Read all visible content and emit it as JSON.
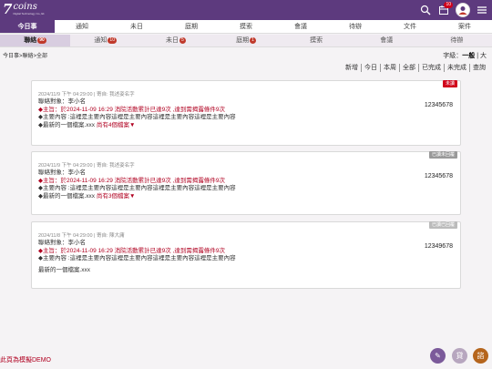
{
  "header": {
    "logo_mark": "7",
    "logo_name": "coins",
    "logo_sub": "Digital Technology Co.,ltd.",
    "notification_count": "10"
  },
  "tabs1": [
    "今日事",
    "通知",
    "未日",
    "庭期",
    "摸索",
    "會議",
    "待辦",
    "文件",
    "案件"
  ],
  "tabs2": [
    {
      "label": "聯絡",
      "count": "90"
    },
    {
      "label": "通知",
      "count": "10"
    },
    {
      "label": "未日",
      "count": "5"
    },
    {
      "label": "庭期",
      "count": "1"
    },
    {
      "label": "摸索",
      "count": ""
    },
    {
      "label": "會議",
      "count": ""
    },
    {
      "label": "待辦",
      "count": ""
    }
  ],
  "breadcrumb": "今日事>聯絡>全部",
  "font_size": {
    "label": "字級：",
    "medium": "一般",
    "sep": "|",
    "large": "大"
  },
  "filters": [
    "新增",
    "今日",
    "本周",
    "全部",
    "已完成",
    "未完成",
    "查詢"
  ],
  "cards": [
    {
      "tag": "未讀",
      "tag_color": "#d0021b",
      "meta": "2024/11/9 下午 04:29:00 | 寄自: 我述姿名字",
      "contact": "聯絡對象：李小名",
      "phone": "12345678",
      "subject": "◆主旨：於2024-11-09 16:29 消院活動累計已達9次 ,達到需揭露條件9次",
      "content": "◆主要內容 :這裡是主要內容這裡是主要內容這裡是主要內容這裡是主要內容",
      "latest": "◆最新的一個檔案.xxx",
      "more": "尚有4個檔案▼"
    },
    {
      "tag": "已讀未回覆",
      "tag_color": "#999999",
      "meta": "2024/11/9 下午 04:29:00 | 寄自: 我述姿名字",
      "contact": "聯絡對象：李小名",
      "phone": "12345678",
      "subject": "◆主旨：於2024-11-09 16:29 消院活動累計已達9次 ,達到需揭露條件9次",
      "content": "◆主要內容 :這裡是主要內容這裡是主要內容這裡是主要內容這裡是主要內容",
      "latest": "◆最新的一個檔案.xxx",
      "more": "尚有3個檔案▼"
    },
    {
      "tag": "已讀已回覆",
      "tag_color": "#bbbbbb",
      "meta": "2024/11/8 下午 04:29:00 | 寄自: 陳大庸",
      "contact": "聯絡對象：李小名",
      "phone": "12349678",
      "subject": "◆主旨：於2024-11-09 16:29 消院活動累計已達9次 ,達到需揭露條件9次",
      "content": "◆主要內容 :這裡是主要內容這裡是主要內容這裡是主要內容這裡是主要內容",
      "latest": "最新的一個檔案.xxx",
      "more": ""
    }
  ],
  "demo_label": "此頁為模擬DEMO",
  "fabs": [
    {
      "icon": "edit-icon",
      "label": "✎",
      "color": "#7b5a9a"
    },
    {
      "icon": "receipt-icon",
      "label": "貸",
      "color": "#b7a6bf"
    },
    {
      "icon": "chat-icon",
      "label": "諮",
      "color": "#b5651d"
    }
  ]
}
